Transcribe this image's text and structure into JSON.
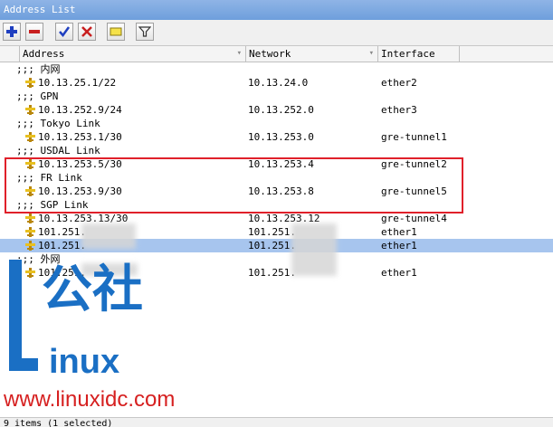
{
  "window": {
    "title": "Address List"
  },
  "toolbar": {
    "buttons": [
      "add-icon",
      "remove-icon",
      "enable-check-icon",
      "disable-x-icon",
      "comment-icon",
      "filter-icon"
    ]
  },
  "columns": [
    "Address",
    "Network",
    "Interface"
  ],
  "rows": [
    {
      "kind": "comment",
      "text": ";;; 内网"
    },
    {
      "kind": "entry",
      "address": "10.13.25.1/22",
      "network": "10.13.24.0",
      "interface": "ether2"
    },
    {
      "kind": "comment",
      "text": ";;; GPN"
    },
    {
      "kind": "entry",
      "address": "10.13.252.9/24",
      "network": "10.13.252.0",
      "interface": "ether3"
    },
    {
      "kind": "comment",
      "text": ";;; Tokyo Link"
    },
    {
      "kind": "entry",
      "address": "10.13.253.1/30",
      "network": "10.13.253.0",
      "interface": "gre-tunnel1"
    },
    {
      "kind": "comment",
      "text": ";;; USDAL Link"
    },
    {
      "kind": "entry",
      "address": "10.13.253.5/30",
      "network": "10.13.253.4",
      "interface": "gre-tunnel2"
    },
    {
      "kind": "comment",
      "text": ";;; FR Link"
    },
    {
      "kind": "entry",
      "address": "10.13.253.9/30",
      "network": "10.13.253.8",
      "interface": "gre-tunnel5"
    },
    {
      "kind": "comment",
      "text": ";;; SGP Link"
    },
    {
      "kind": "entry",
      "address": "10.13.253.13/30",
      "network": "10.13.253.12",
      "interface": "gre-tunnel4"
    },
    {
      "kind": "entry",
      "address": "101.251.",
      "network": "101.251.",
      "interface": "ether1"
    },
    {
      "kind": "entry",
      "address": "101.251.",
      "network": "101.251.",
      "interface": "ether1",
      "selected": true
    },
    {
      "kind": "comment",
      "text": ";;; 外网"
    },
    {
      "kind": "entry",
      "address": "101.251.",
      "network": "101.251.",
      "interface": "ether1"
    }
  ],
  "status": {
    "text": "9 items (1 selected)"
  },
  "watermark": {
    "brand": "公社",
    "word": "inux",
    "url": "www.linuxidc.com"
  },
  "colors": {
    "selection": "#a7c5ee",
    "highlight_box": "#e0202a",
    "watermark_blue": "#1a6fc4",
    "watermark_red": "#d62020"
  }
}
